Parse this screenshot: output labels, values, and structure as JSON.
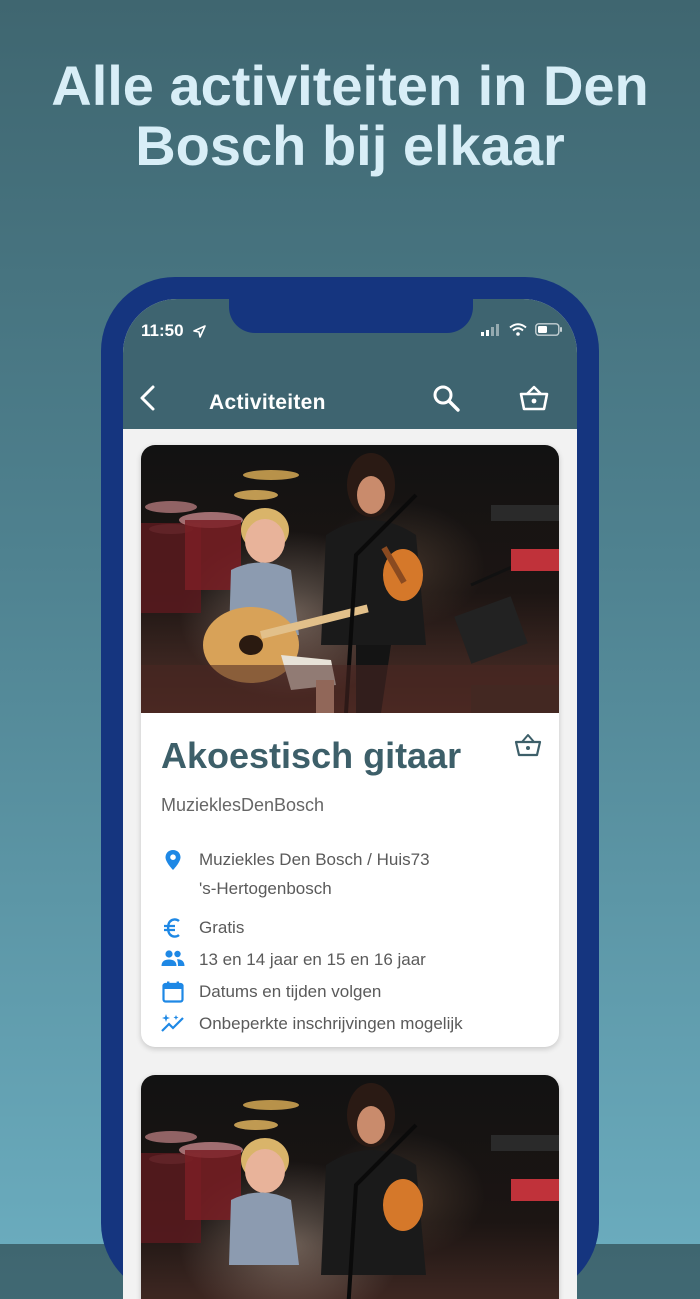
{
  "headline": "Alle activiteiten in Den Bosch bij elkaar",
  "status_bar": {
    "time": "11:50"
  },
  "toolbar": {
    "title": "Activiteiten"
  },
  "activities": [
    {
      "title": "Akoestisch gitaar",
      "organizer": "MuzieklesDenBosch",
      "location_line1": "Muziekles Den Bosch / Huis73",
      "location_line2": "'s-Hertogenbosch",
      "price": "Gratis",
      "ages": "13 en 14 jaar en 15 en 16 jaar",
      "schedule": "Datums en tijden volgen",
      "capacity": "Onbeperkte inschrijvingen mogelijk"
    }
  ],
  "icons": {
    "location": "location-pin-icon",
    "price": "euro-icon",
    "ages": "people-icon",
    "schedule": "calendar-icon",
    "capacity": "sparkle-trend-icon",
    "basket": "basket-icon",
    "search": "search-icon",
    "back": "back-chevron-icon"
  },
  "colors": {
    "toolbar": "#3e6470",
    "phone_frame": "#15357f",
    "title_text": "#3d5f69",
    "icon_blue": "#1e88e5"
  }
}
